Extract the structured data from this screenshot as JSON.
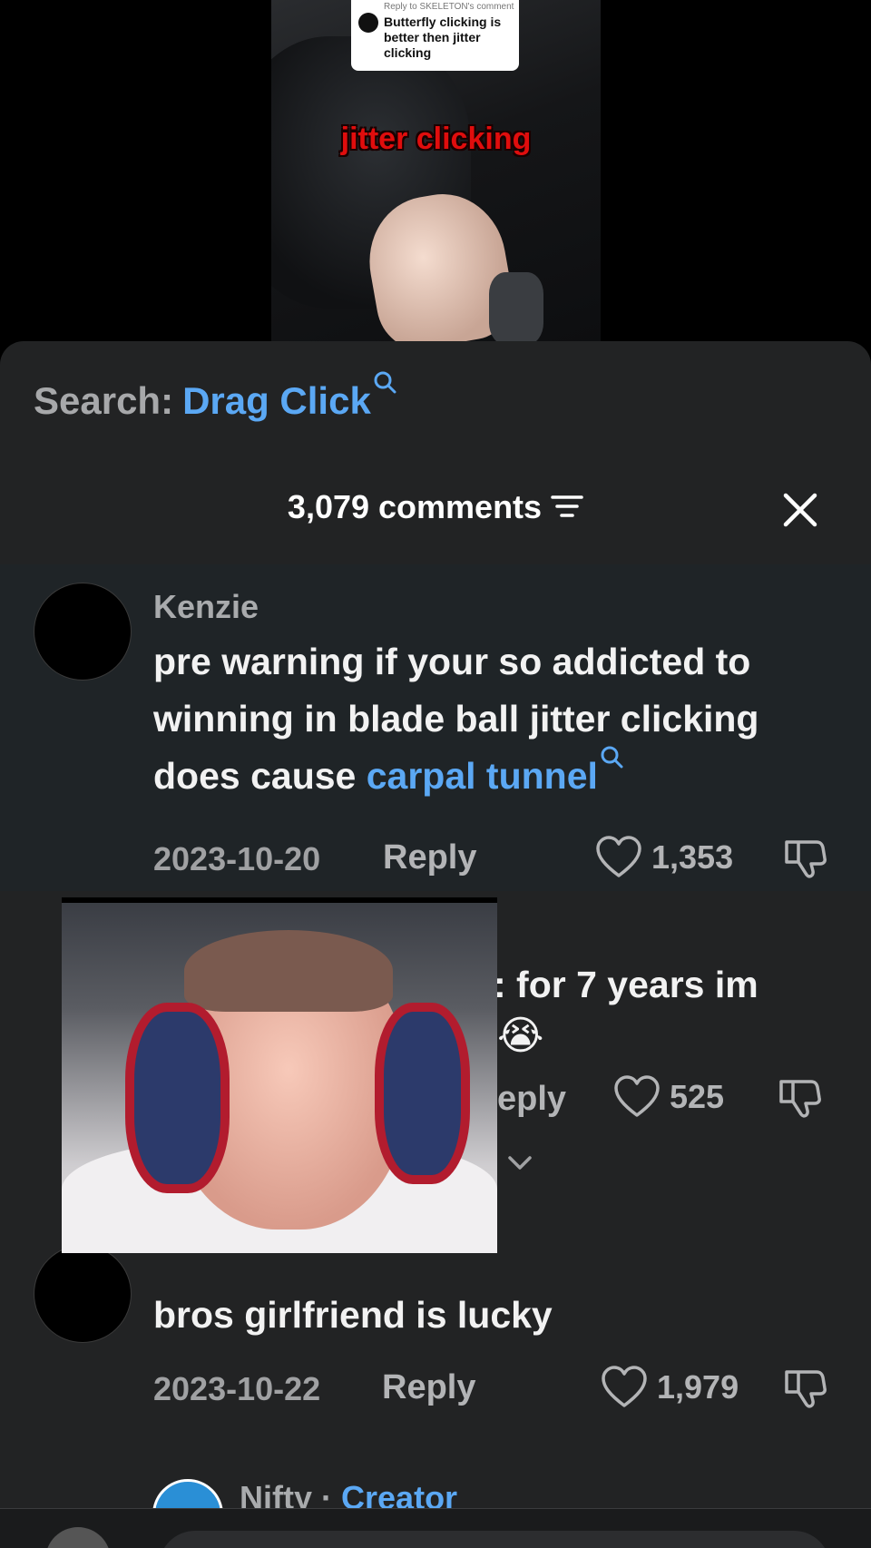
{
  "video": {
    "reply_header": "Reply to SKELETON's comment",
    "reply_text": "Butterfly clicking is better then jitter clicking",
    "caption": "jitter clicking"
  },
  "search": {
    "label": "Search:",
    "term": "Drag Click"
  },
  "comments_header": {
    "count_text": "3,079 comments"
  },
  "colors": {
    "sheet_bg": "#222324",
    "link": "#5ba8f4",
    "highlight_bg": "#1f2427",
    "caption_red": "#e00d0d"
  },
  "comments": [
    {
      "username": "Kenzie",
      "text_before": "pre warning if your so addicted to winning in blade ball jitter clicking does cause ",
      "link": "carpal tunnel",
      "date": "2023-10-20",
      "reply_label": "Reply",
      "likes": "1,353"
    },
    {
      "text_line1": ": for 7 years im",
      "emoji": "😭",
      "reply_label": "eply",
      "likes": "525"
    },
    {
      "text": "bros girlfriend is lucky",
      "date": "2023-10-22",
      "reply_label": "Reply",
      "likes": "1,979"
    },
    {
      "username": "Nifty",
      "separator": "·",
      "badge": "Creator"
    }
  ]
}
